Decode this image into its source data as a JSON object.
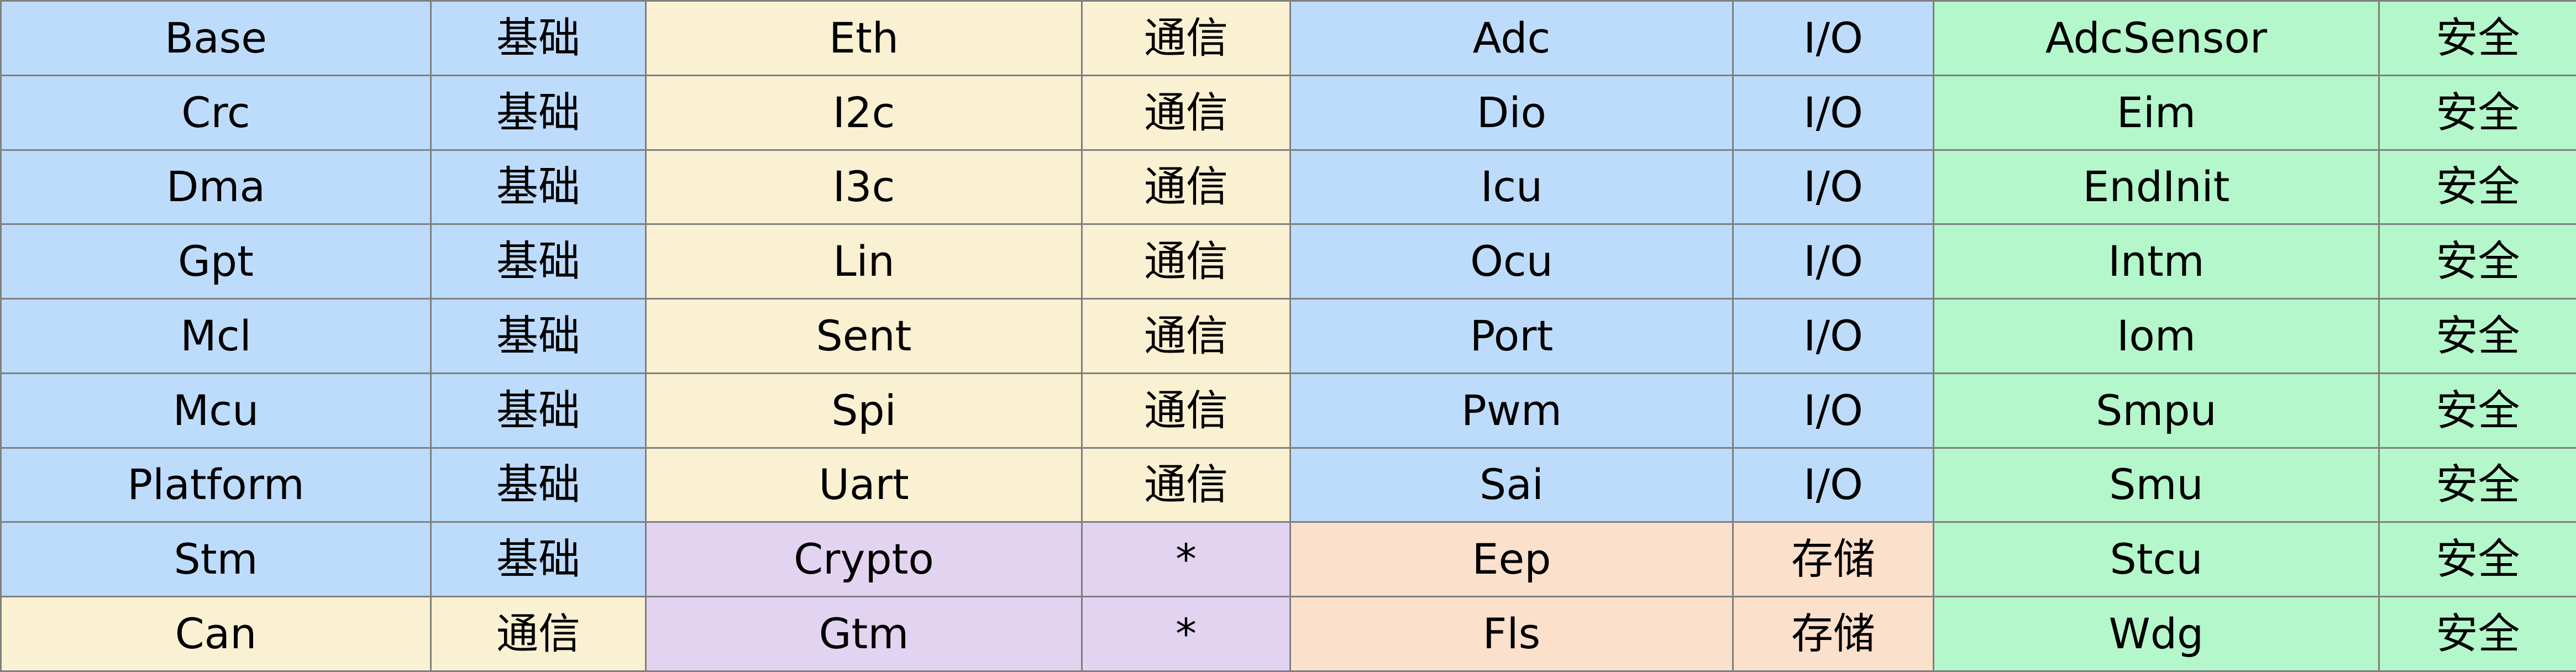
{
  "colors": {
    "基础": "#bddcfb",
    "通信": "#f9f1d2",
    "I/O": "#bddcfb",
    "安全": "#b3f7cb",
    "*": "#e2d4f1",
    "存储": "#fbe0cc"
  },
  "rows": [
    [
      [
        "Base",
        "基础"
      ],
      [
        "Eth",
        "通信"
      ],
      [
        "Adc",
        "I/O"
      ],
      [
        "AdcSensor",
        "安全"
      ]
    ],
    [
      [
        "Crc",
        "基础"
      ],
      [
        "I2c",
        "通信"
      ],
      [
        "Dio",
        "I/O"
      ],
      [
        "Eim",
        "安全"
      ]
    ],
    [
      [
        "Dma",
        "基础"
      ],
      [
        "I3c",
        "通信"
      ],
      [
        "Icu",
        "I/O"
      ],
      [
        "EndInit",
        "安全"
      ]
    ],
    [
      [
        "Gpt",
        "基础"
      ],
      [
        "Lin",
        "通信"
      ],
      [
        "Ocu",
        "I/O"
      ],
      [
        "Intm",
        "安全"
      ]
    ],
    [
      [
        "Mcl",
        "基础"
      ],
      [
        "Sent",
        "通信"
      ],
      [
        "Port",
        "I/O"
      ],
      [
        "Iom",
        "安全"
      ]
    ],
    [
      [
        "Mcu",
        "基础"
      ],
      [
        "Spi",
        "通信"
      ],
      [
        "Pwm",
        "I/O"
      ],
      [
        "Smpu",
        "安全"
      ]
    ],
    [
      [
        "Platform",
        "基础"
      ],
      [
        "Uart",
        "通信"
      ],
      [
        "Sai",
        "I/O"
      ],
      [
        "Smu",
        "安全"
      ]
    ],
    [
      [
        "Stm",
        "基础"
      ],
      [
        "Crypto",
        "*"
      ],
      [
        "Eep",
        "存储"
      ],
      [
        "Stcu",
        "安全"
      ]
    ],
    [
      [
        "Can",
        "通信"
      ],
      [
        "Gtm",
        "*"
      ],
      [
        "Fls",
        "存储"
      ],
      [
        "Wdg",
        "安全"
      ]
    ]
  ]
}
